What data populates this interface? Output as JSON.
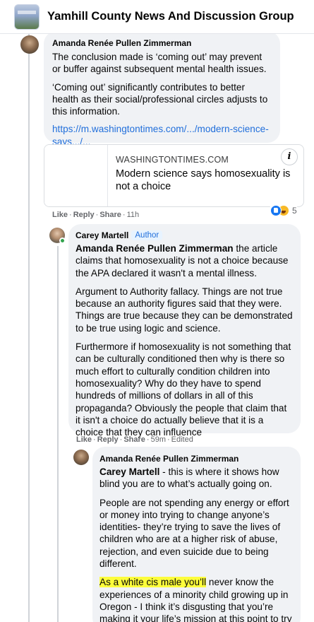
{
  "group": {
    "title": "Yamhill County News And Discussion Group"
  },
  "comment1": {
    "author": "Amanda Renée Pullen Zimmerman",
    "paragraphs": [
      "The conclusion made is ‘coming out’ may prevent or buffer against subsequent mental health issues.",
      "‘Coming out’ significantly contributes to better health as their social/professional circles adjusts to this information."
    ],
    "link_text": "https://m.washingtontimes.com/.../modern-science-says.../...",
    "card": {
      "domain": "WASHINGTONTIMES.COM",
      "title": "Modern science says homosexuality is not a choice",
      "info_icon": "info-icon"
    },
    "actions": {
      "like": "Like",
      "reply": "Reply",
      "share": "Share",
      "time": "11h"
    },
    "reactions": {
      "types": [
        "like",
        "haha"
      ],
      "count": "5"
    }
  },
  "comment2": {
    "author": "Carey Martell",
    "badge": "Author",
    "mention": "Amanda Renée Pullen Zimmerman",
    "first_text": " the article claims that homosexuality is not a choice because the APA declared it wasn't a mental illness.",
    "paragraphs": [
      "Argument to Authority fallacy. Things are not true because an authority figures said that they were. Things are true because they can be demonstrated to be true using logic and science.",
      "Furthermore if homosexuality is not something that can be culturally conditioned then why is there so much effort to culturally condition children into homosexuality? Why do they have to spend hundreds of millions of dollars in all of this propaganda? Obviously the people that claim that it isn't a choice do actually believe that it is a choice that they can influence"
    ],
    "actions": {
      "like": "Like",
      "reply": "Reply",
      "share": "Share",
      "time": "59m",
      "edited": "Edited"
    }
  },
  "comment3": {
    "author": "Amanda Renée Pullen Zimmerman",
    "mention": "Carey Martell",
    "first_text": " - this is where it shows how blind you are to what’s actually going on.",
    "paragraph2": "People are not spending any energy or effort or money into trying to change anyone’s identities- they’re trying to save the lives of children who are at a higher risk of abuse, rejection, and even suicide due to being different.",
    "highlight": "As a white cis male you’ll",
    "paragraph3_rest": " never know the experiences of a minority child growing up in Oregon - I think it’s disgusting that you’re making it your life’s mission at this point to try to get in the way of people who are just"
  }
}
